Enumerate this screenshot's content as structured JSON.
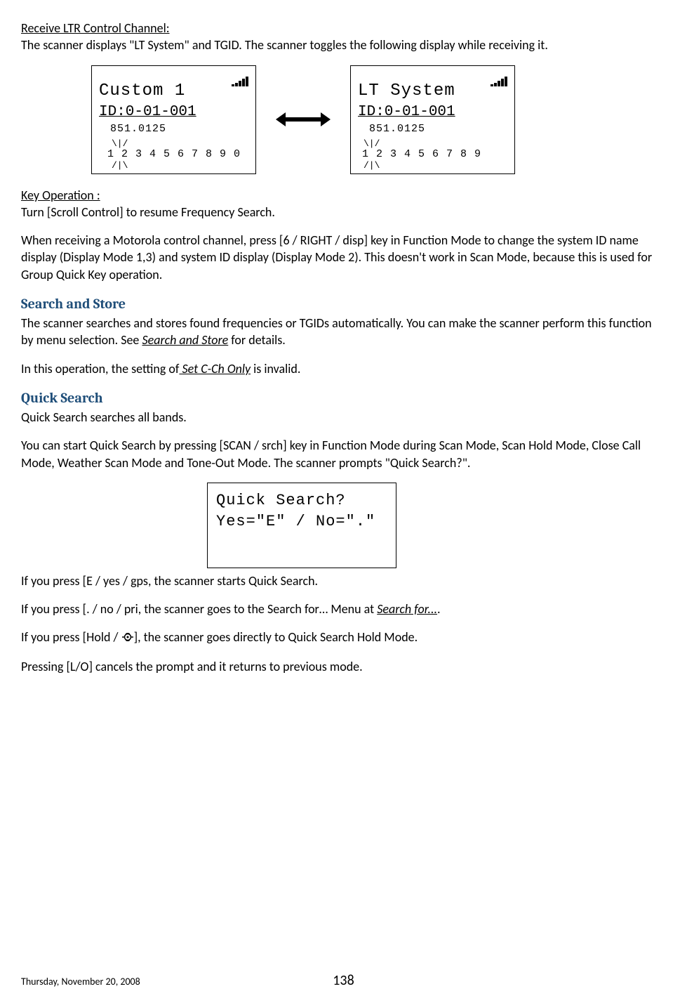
{
  "heading1": "Receive LTR Control Channel:",
  "intro": "The scanner displays \"LT System\" and TGID. The scanner toggles the following display while receiving it.",
  "lcd1": {
    "title": "Custom 1",
    "id": "ID:0-01-001",
    "freq": "851.0125",
    "ant_top": "\\|/",
    "nums": "1 2 3 4 5 6 7 8 9 0",
    "ant_bot": "/|\\"
  },
  "lcd2": {
    "title": "LT System",
    "id": "ID:0-01-001",
    "freq": "851.0125",
    "ant_top": "\\|/",
    "nums": "1 2 3 4 5 6 7 8 9",
    "ant_bot": "/|\\"
  },
  "keyop_heading": "Key Operation :",
  "keyop_text": "Turn [Scroll Control] to resume Frequency Search.",
  "motorola_text": "When receiving a Motorola control channel, press [6 / RIGHT / disp] key in Function Mode to change the system ID name display (Display Mode 1,3) and system ID display (Display Mode 2). This doesn't work in Scan Mode, because this is used for Group Quick Key operation.",
  "search_store": {
    "title": "Search and Store",
    "p1a": "The scanner searches and stores found frequencies or TGIDs automatically. You can make the scanner perform this function by menu selection. See ",
    "p1_link": "Search and Store",
    "p1b": " for details.",
    "p2a": "In this operation, the setting of",
    "p2_link": " Set C-Ch Only",
    "p2b": " is invalid."
  },
  "quick_search": {
    "title": "Quick Search",
    "p1": "Quick Search searches all bands.",
    "p2": "You can start Quick Search by pressing [SCAN / srch] key in Function Mode during Scan Mode, Scan Hold Mode, Close Call Mode, Weather Scan Mode and Tone-Out Mode. The scanner prompts \"Quick Search?\"."
  },
  "lcd3": {
    "line1": "Quick Search?",
    "line2": "Yes=\"E\" / No=\".\""
  },
  "after_lcd": {
    "p1": "If you press  [E / yes / gps, the scanner starts Quick Search.",
    "p2a": "If you press [. / no / pri, the scanner goes to the Search for… Menu at ",
    "p2_link": "Search for...",
    "p2b": ".",
    "p3a": "If you press [Hold / ",
    "p3b": "], the scanner goes directly to Quick Search Hold Mode.",
    "p4": "Pressing [L/O] cancels the prompt and it returns to previous mode."
  },
  "footer": {
    "date": "Thursday, November 20, 2008",
    "page": "138"
  }
}
